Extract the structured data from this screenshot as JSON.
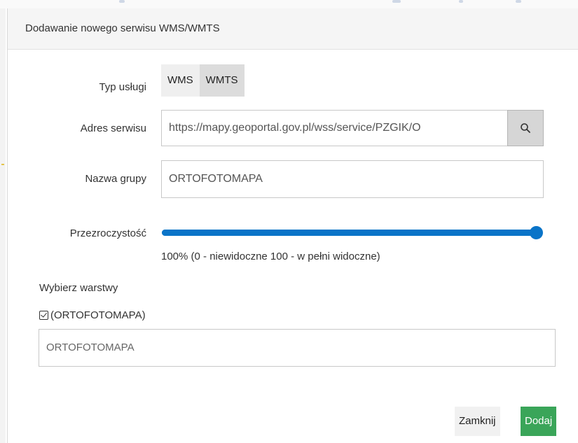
{
  "dialog": {
    "title": "Dodawanie nowego serwisu WMS/WMTS"
  },
  "service_type": {
    "label": "Typ usługi",
    "options": [
      "WMS",
      "WMTS"
    ],
    "selected": "WMTS"
  },
  "service_url": {
    "label": "Adres serwisu",
    "value": "https://mapy.geoportal.gov.pl/wss/service/PZGIK/O",
    "search_icon": "search-icon"
  },
  "group_name": {
    "label": "Nazwa grupy",
    "value": "ORTOFOTOMAPA"
  },
  "opacity": {
    "label": "Przezroczystość",
    "value_percent": 100,
    "caption": "100% (0 - niewidoczne 100 - w pełni widoczne)"
  },
  "layers": {
    "section_label": "Wybierz warstwy",
    "items": [
      {
        "label": "(ORTOFOTOMAPA)",
        "checked": true
      }
    ],
    "field_value": "ORTOFOTOMAPA"
  },
  "footer": {
    "close_label": "Zamknij",
    "add_label": "Dodaj"
  },
  "colors": {
    "accent": "#0a74c8",
    "add_button": "#3aa559",
    "header_bg": "#f5f5f5"
  }
}
